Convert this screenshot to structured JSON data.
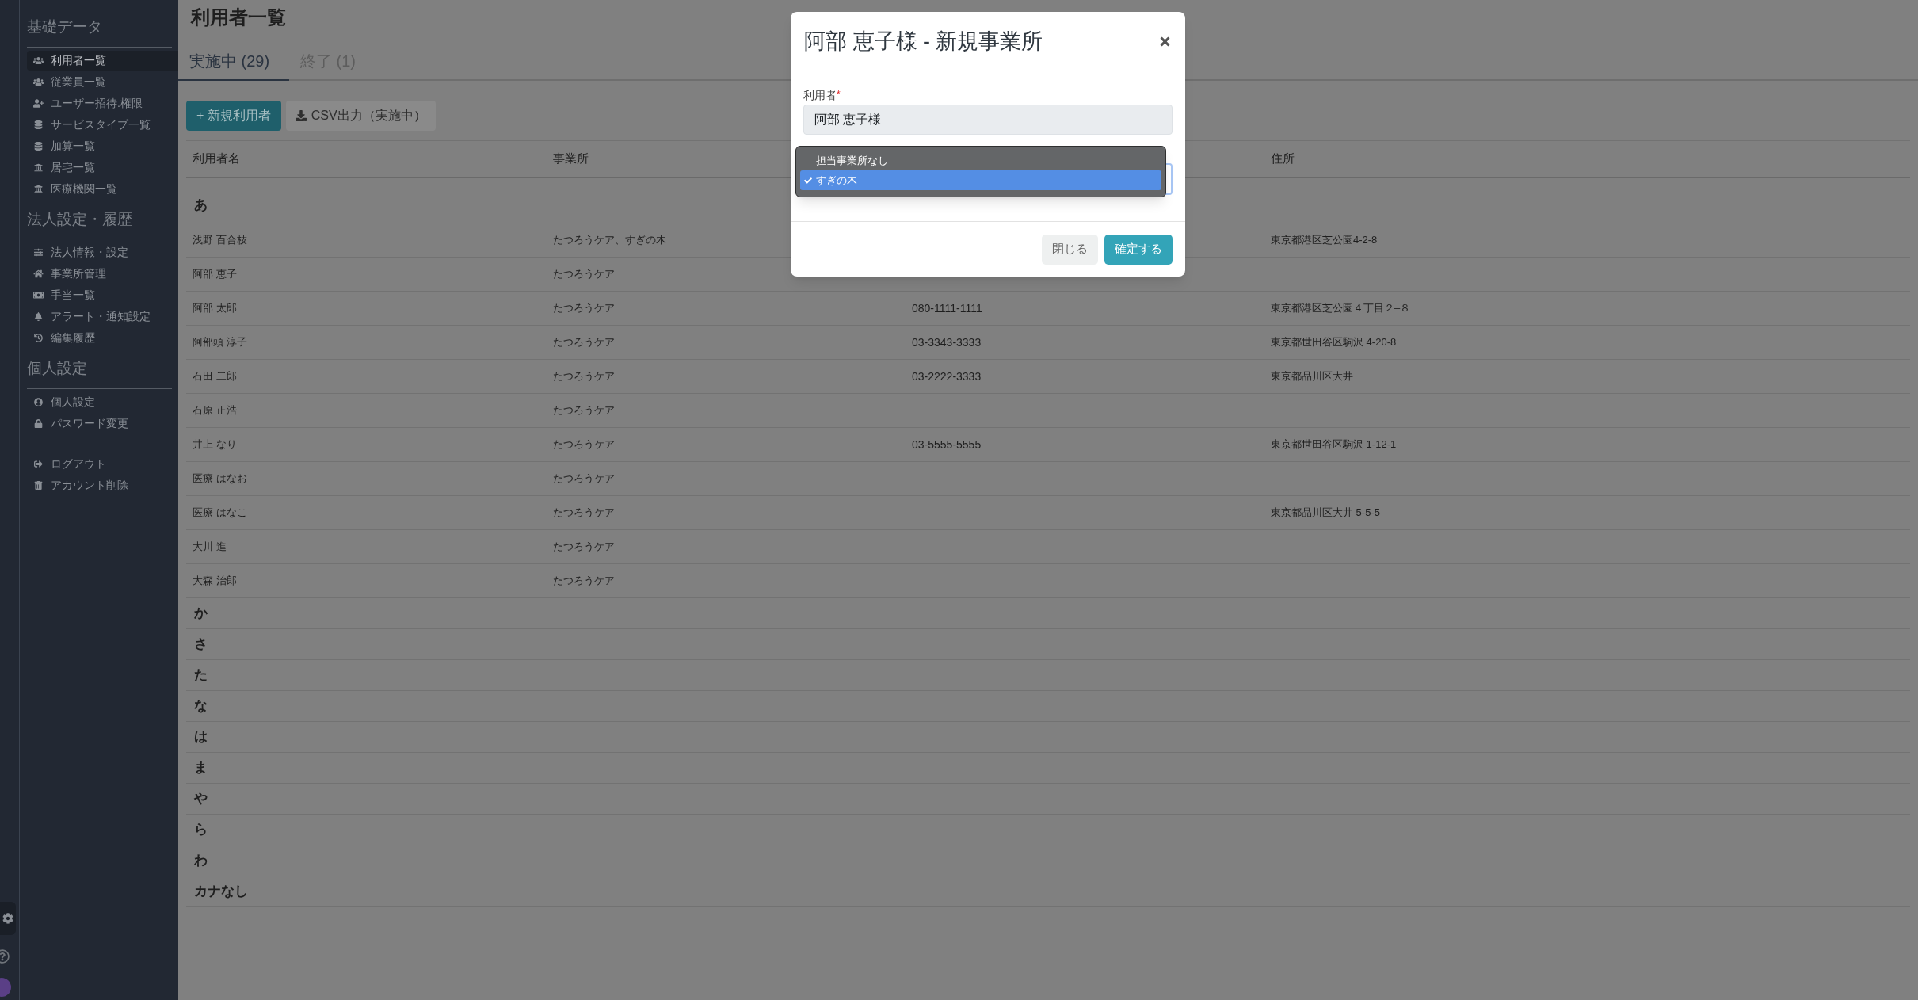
{
  "sidebar": {
    "sections": [
      {
        "heading": "基礎データ",
        "items": [
          {
            "label": "利用者一覧",
            "kind": "users",
            "selected": true
          },
          {
            "label": "従業員一覧",
            "kind": "users",
            "selected": false
          },
          {
            "label": "ユーザー招待.権限",
            "kind": "invite",
            "selected": false
          },
          {
            "label": "サービスタイプ一覧",
            "kind": "master",
            "selected": false
          },
          {
            "label": "加算一覧",
            "kind": "master",
            "selected": false
          },
          {
            "label": "居宅一覧",
            "kind": "facility",
            "selected": false
          },
          {
            "label": "医療機関一覧",
            "kind": "facility",
            "selected": false
          }
        ]
      },
      {
        "heading": "法人設定・履歴",
        "items": [
          {
            "label": "法人情報・設定",
            "kind": "settings",
            "selected": false
          },
          {
            "label": "事業所管理",
            "kind": "office",
            "selected": false
          },
          {
            "label": "手当一覧",
            "kind": "allowance",
            "selected": false
          },
          {
            "label": "アラート・通知設定",
            "kind": "alert",
            "selected": false
          },
          {
            "label": "編集履歴",
            "kind": "history",
            "selected": false
          }
        ]
      },
      {
        "heading": "個人設定",
        "items": [
          {
            "label": "個人設定",
            "kind": "profile",
            "selected": false
          },
          {
            "label": "パスワード変更",
            "kind": "password",
            "selected": false
          }
        ]
      },
      {
        "items": [
          {
            "label": "ログアウト",
            "kind": "logout",
            "selected": false
          },
          {
            "label": "アカウント削除",
            "kind": "delete",
            "selected": false
          }
        ]
      }
    ]
  },
  "page_title": "利用者一覧",
  "tabs": [
    {
      "label": "実施中 (29)",
      "selected": true
    },
    {
      "label": "終了 (1)",
      "selected": false
    }
  ],
  "toolbar": {
    "new_button": "+ 新規利用者",
    "csv_button": "CSV出力（実施中）"
  },
  "table": {
    "headers": {
      "name": "利用者名",
      "office": "事業所",
      "address": "住所"
    },
    "groups": [
      {
        "kana": "あ",
        "rows": [
          {
            "name": "浅野 百合枝",
            "office": "たつろうケア、すぎの木",
            "address": "東京都港区芝公園4-2-8"
          },
          {
            "name": "阿部 恵子",
            "office": "たつろうケア"
          },
          {
            "name": "阿部 太郎",
            "office": "たつろうケア",
            "phone": "080-1111-1111",
            "address": "東京都港区芝公園４丁目２–８"
          },
          {
            "name": "阿部頭 淳子",
            "office": "たつろうケア",
            "phone": "03-3343-3333",
            "address": "東京都世田谷区駒沢 4-20-8"
          },
          {
            "name": "石田 二郎",
            "office": "たつろうケア",
            "phone": "03-2222-3333",
            "address": "東京都品川区大井"
          },
          {
            "name": "石原 正浩",
            "office": "たつろうケア"
          },
          {
            "name": "井上 なり",
            "office": "たつろうケア",
            "phone": "03-5555-5555",
            "address": "東京都世田谷区駒沢 1-12-1"
          },
          {
            "name": "医療 はなお",
            "office": "たつろうケア"
          },
          {
            "name": "医療 はなこ",
            "office": "たつろうケア",
            "address": "東京都品川区大井 5-5-5"
          },
          {
            "name": "大川 進",
            "office": "たつろうケア"
          },
          {
            "name": "大森 治郎",
            "office": "たつろうケア"
          }
        ]
      },
      {
        "kana": "か"
      },
      {
        "kana": "さ"
      },
      {
        "kana": "た"
      },
      {
        "kana": "な"
      },
      {
        "kana": "は"
      },
      {
        "kana": "ま"
      },
      {
        "kana": "や"
      },
      {
        "kana": "ら"
      },
      {
        "kana": "わ"
      },
      {
        "kana": "カナなし"
      }
    ]
  },
  "modal": {
    "title": "阿部 恵子様 - 新規事業所",
    "field_label": "利用者",
    "required_mark": "*",
    "field_value": "阿部 恵子様",
    "dropdown": {
      "options": [
        {
          "label": "担当事業所なし",
          "selected": false
        },
        {
          "label": "すぎの木",
          "selected": true
        }
      ]
    },
    "close_button": "閉じる",
    "confirm_button": "確定する"
  }
}
